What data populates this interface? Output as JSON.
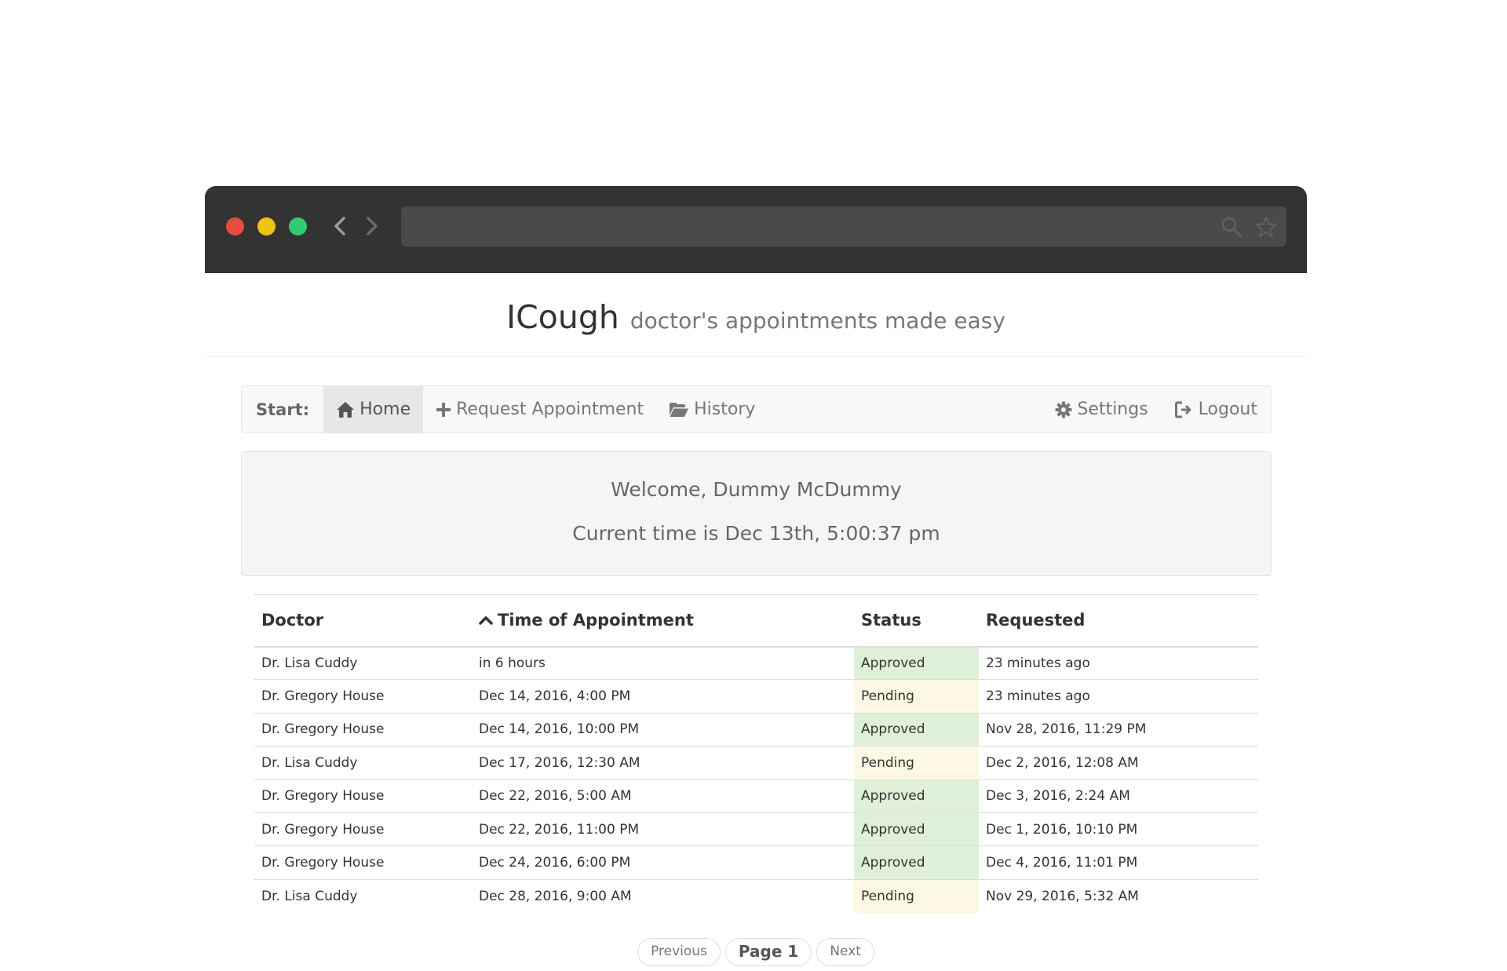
{
  "app": {
    "brand": "ICough",
    "tagline": "doctor's appointments made easy"
  },
  "colors": {
    "chrome": "#333333",
    "address_bar": "#4a4a4a",
    "close": "#e74c3c",
    "minimize": "#f1c40f",
    "maximize": "#2ecc71",
    "approved_bg": "#dff0d8",
    "pending_bg": "#fcf8e3"
  },
  "browser": {
    "back_icon": "chevron-left-icon",
    "forward_icon": "chevron-right-icon",
    "search_icon": "search-icon",
    "bookmark_icon": "star-icon"
  },
  "nav": {
    "start_label": "Start:",
    "home": "Home",
    "request": "Request Appointment",
    "history": "History",
    "settings": "Settings",
    "logout": "Logout"
  },
  "welcome": {
    "greeting": "Welcome, Dummy McDummy",
    "time": "Current time is Dec 13th, 5:00:37 pm"
  },
  "table": {
    "headers": {
      "doctor": "Doctor",
      "time": "Time of Appointment",
      "status": "Status",
      "requested": "Requested"
    },
    "rows": [
      {
        "doctor": "Dr. Lisa Cuddy",
        "time": "in 6 hours",
        "status": "Approved",
        "requested": "23 minutes ago"
      },
      {
        "doctor": "Dr. Gregory House",
        "time": "Dec 14, 2016, 4:00 PM",
        "status": "Pending",
        "requested": "23 minutes ago"
      },
      {
        "doctor": "Dr. Gregory House",
        "time": "Dec 14, 2016, 10:00 PM",
        "status": "Approved",
        "requested": "Nov 28, 2016, 11:29 PM"
      },
      {
        "doctor": "Dr. Lisa Cuddy",
        "time": "Dec 17, 2016, 12:30 AM",
        "status": "Pending",
        "requested": "Dec 2, 2016, 12:08 AM"
      },
      {
        "doctor": "Dr. Gregory House",
        "time": "Dec 22, 2016, 5:00 AM",
        "status": "Approved",
        "requested": "Dec 3, 2016, 2:24 AM"
      },
      {
        "doctor": "Dr. Gregory House",
        "time": "Dec 22, 2016, 11:00 PM",
        "status": "Approved",
        "requested": "Dec 1, 2016, 10:10 PM"
      },
      {
        "doctor": "Dr. Gregory House",
        "time": "Dec 24, 2016, 6:00 PM",
        "status": "Approved",
        "requested": "Dec 4, 2016, 11:01 PM"
      },
      {
        "doctor": "Dr. Lisa Cuddy",
        "time": "Dec 28, 2016, 9:00 AM",
        "status": "Pending",
        "requested": "Nov 29, 2016, 5:32 AM"
      }
    ]
  },
  "pager": {
    "previous": "Previous",
    "current": "Page 1",
    "next": "Next"
  }
}
